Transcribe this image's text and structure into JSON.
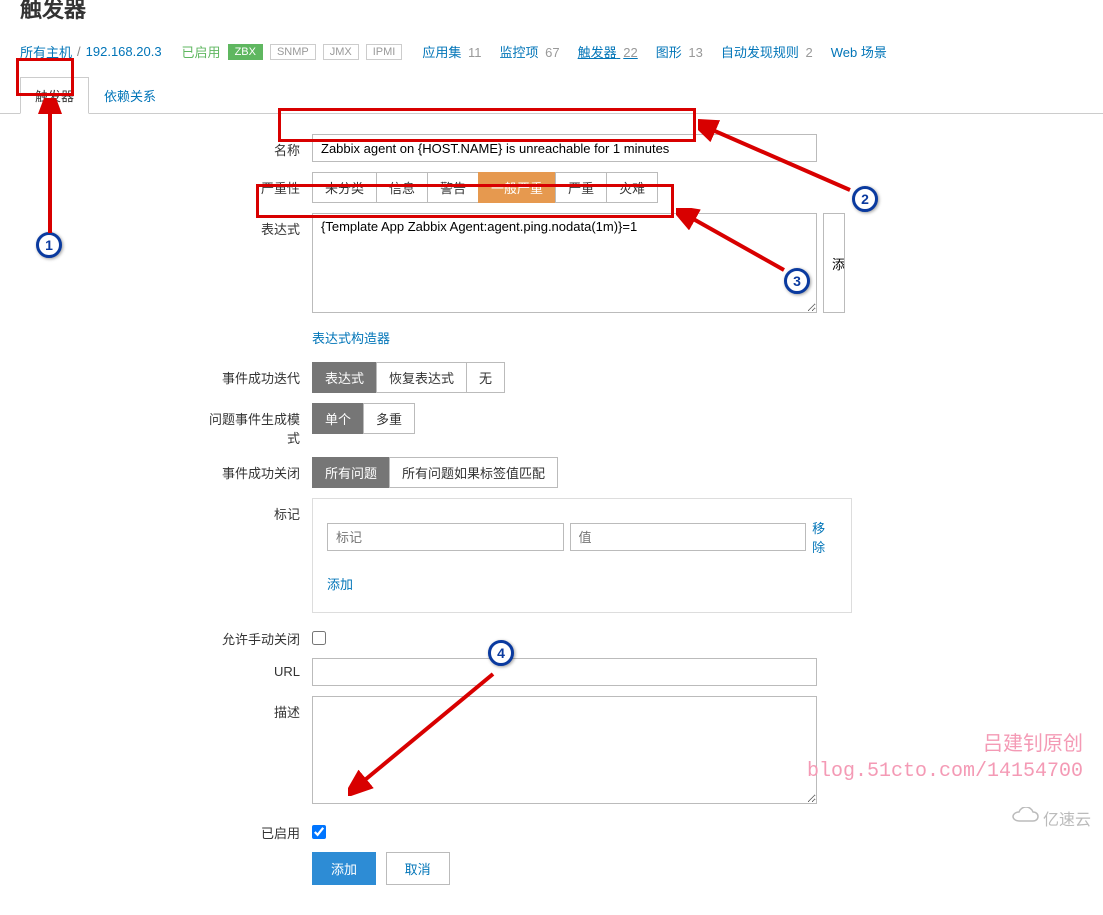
{
  "page_title": "触发器",
  "breadcrumb": {
    "all_hosts": "所有主机",
    "host_ip": "192.168.20.3"
  },
  "status": "已启用",
  "badges": {
    "zbx": "ZBX",
    "snmp": "SNMP",
    "jmx": "JMX",
    "ipmi": "IPMI"
  },
  "nav": [
    {
      "label": "应用集",
      "count": "11"
    },
    {
      "label": "监控项",
      "count": "67"
    },
    {
      "label": "触发器",
      "count": "22",
      "current": true
    },
    {
      "label": "图形",
      "count": "13"
    },
    {
      "label": "自动发现规则",
      "count": "2"
    },
    {
      "label": "Web 场景",
      "count": ""
    }
  ],
  "tabs": {
    "trigger": "触发器",
    "deps": "依赖关系"
  },
  "form": {
    "name_label": "名称",
    "name_value": "Zabbix agent on {HOST.NAME} is unreachable for 1 minutes",
    "severity_label": "严重性",
    "severity_opts": [
      "未分类",
      "信息",
      "警告",
      "一般严重",
      "严重",
      "灾难"
    ],
    "expr_label": "表达式",
    "expr_value": "{Template App Zabbix Agent:agent.ping.nodata(1m)}=1",
    "expr_add_btn": "添",
    "expr_builder": "表达式构造器",
    "event_ok_label": "事件成功迭代",
    "event_ok_opts": [
      "表达式",
      "恢复表达式",
      "无"
    ],
    "problem_mode_label": "问题事件生成模式",
    "problem_mode_opts": [
      "单个",
      "多重"
    ],
    "ok_close_label": "事件成功关闭",
    "ok_close_opts": [
      "所有问题",
      "所有问题如果标签值匹配"
    ],
    "tags_label": "标记",
    "tag_name_ph": "标记",
    "tag_value_ph": "值",
    "tag_remove": "移除",
    "tag_add": "添加",
    "manual_close_label": "允许手动关闭",
    "url_label": "URL",
    "desc_label": "描述",
    "enabled_label": "已启用",
    "submit": "添加",
    "cancel": "取消"
  },
  "watermark": {
    "line1": "吕建钊原创",
    "line2": "blog.51cto.com/14154700"
  },
  "logo_text": "亿速云"
}
